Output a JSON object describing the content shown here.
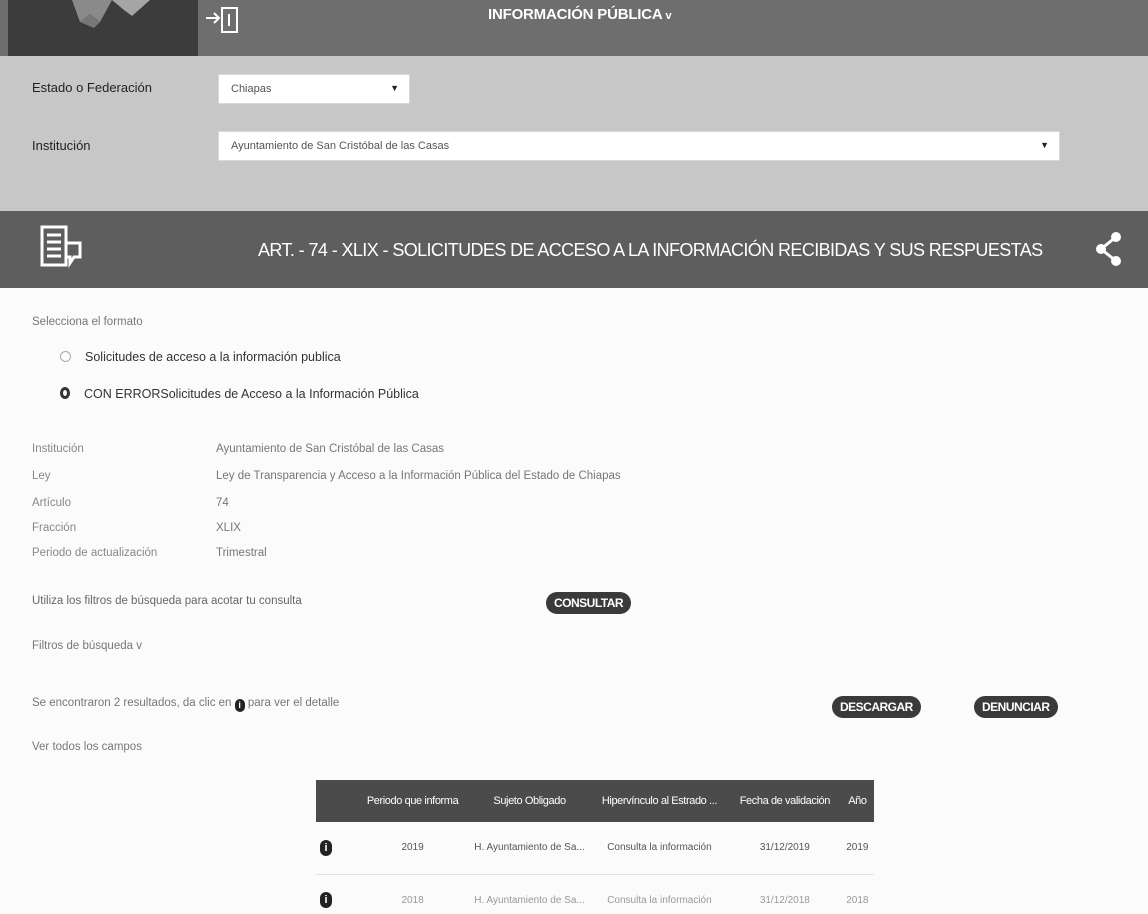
{
  "header": {
    "menu_title": "INFORMACIÓN PÚBLICA",
    "menu_chevron": "v"
  },
  "filters": {
    "estado_label": "Estado o Federación",
    "estado_value": "Chiapas",
    "institucion_label": "Institución",
    "institucion_value": "Ayuntamiento de San Cristóbal de las Casas"
  },
  "article": {
    "title": "ART. - 74 - XLIX - SOLICITUDES DE ACCESO A LA INFORMACIÓN RECIBIDAS Y SUS RESPUESTAS"
  },
  "format": {
    "label": "Selecciona el formato",
    "options": [
      {
        "label": "Solicitudes de acceso a la información publica",
        "selected": false
      },
      {
        "label": "CON ERRORSolicitudes de Acceso a la Información Pública",
        "selected": true
      }
    ]
  },
  "details": {
    "rows": [
      {
        "key": "Institución",
        "value": "Ayuntamiento de San Cristóbal de las Casas"
      },
      {
        "key": "Ley",
        "value": "Ley de Transparencia y Acceso a la Información Pública del Estado de Chiapas"
      },
      {
        "key": "Artículo",
        "value": "74"
      },
      {
        "key": "Fracción",
        "value": "XLIX"
      },
      {
        "key": "Periodo de actualización",
        "value": "Trimestral"
      }
    ]
  },
  "search": {
    "hint": "Utiliza los filtros de búsqueda para acotar tu consulta",
    "consultar": "CONSULTAR",
    "filters_toggle": "Filtros de búsqueda",
    "filters_chevron": "v"
  },
  "results": {
    "found_prefix": "Se encontraron 2 resultados, da clic en",
    "found_icon": "i",
    "found_suffix": "para ver el detalle",
    "descargar": "DESCARGAR",
    "denunciar": "DENUNCIAR",
    "ver_todos": "Ver todos los campos"
  },
  "table": {
    "headers": [
      "Periodo que informa",
      "Sujeto Obligado",
      "Hipervínculo al Estrado ...",
      "Fecha de validación",
      "Año"
    ],
    "info_icon": "i",
    "rows": [
      [
        "2019",
        "H. Ayuntamiento de Sa...",
        "Consulta la información",
        "31/12/2019",
        "2019"
      ],
      [
        "2018",
        "H. Ayuntamiento de Sa...",
        "Consulta la información",
        "31/12/2018",
        "2018"
      ]
    ]
  },
  "colors": {
    "topbar": "#6e6e6e",
    "filters_bg": "#c7c7c7",
    "article_band": "#5e5e5e",
    "button_dark": "#3a3a3a"
  }
}
